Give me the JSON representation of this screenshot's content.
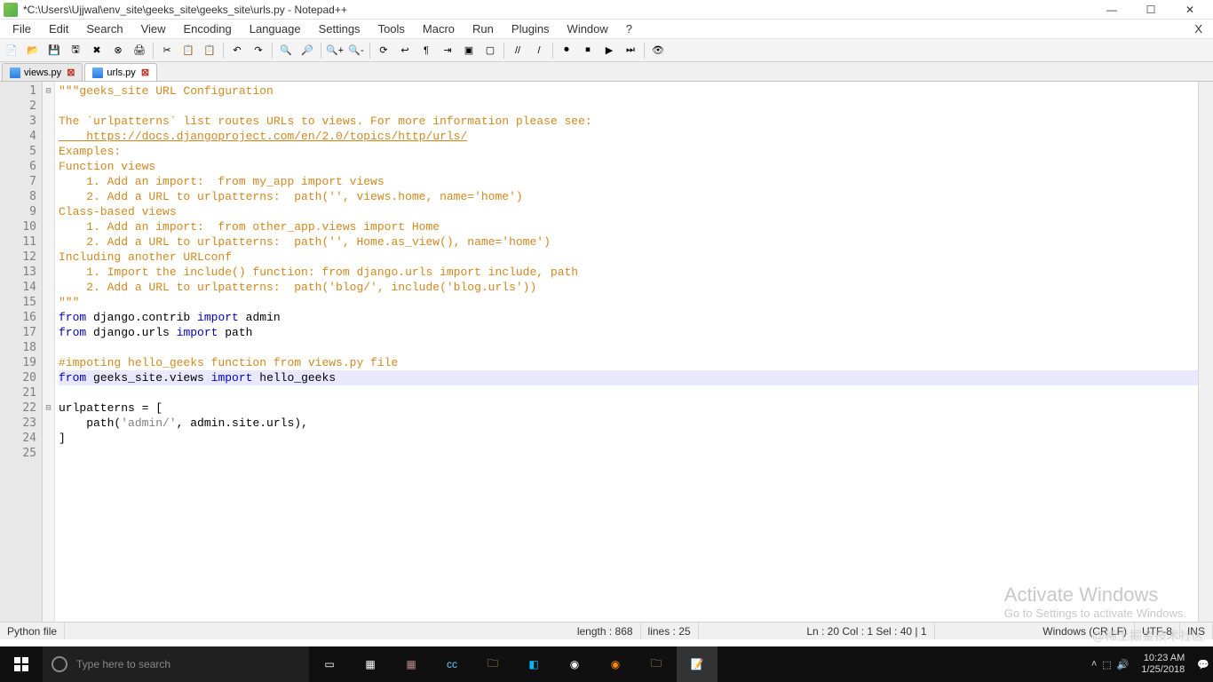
{
  "window": {
    "title": "*C:\\Users\\Ujjwal\\env_site\\geeks_site\\geeks_site\\urls.py - Notepad++"
  },
  "menus": [
    "File",
    "Edit",
    "Search",
    "View",
    "Encoding",
    "Language",
    "Settings",
    "Tools",
    "Macro",
    "Run",
    "Plugins",
    "Window",
    "?"
  ],
  "tabs": [
    {
      "label": "views.py",
      "active": false
    },
    {
      "label": "urls.py",
      "active": true
    }
  ],
  "code": {
    "lines": [
      {
        "n": 1,
        "cls": "s-doc",
        "text": "\"\"\"geeks_site URL Configuration",
        "fold": "⊟"
      },
      {
        "n": 2,
        "cls": "s-doc",
        "text": ""
      },
      {
        "n": 3,
        "cls": "s-doc",
        "text": "The `urlpatterns` list routes URLs to views. For more information please see:"
      },
      {
        "n": 4,
        "cls": "s-link",
        "text": "    https://docs.djangoproject.com/en/2.0/topics/http/urls/"
      },
      {
        "n": 5,
        "cls": "s-doc",
        "text": "Examples:"
      },
      {
        "n": 6,
        "cls": "s-doc",
        "text": "Function views"
      },
      {
        "n": 7,
        "cls": "s-doc",
        "text": "    1. Add an import:  from my_app import views"
      },
      {
        "n": 8,
        "cls": "s-doc",
        "text": "    2. Add a URL to urlpatterns:  path('', views.home, name='home')"
      },
      {
        "n": 9,
        "cls": "s-doc",
        "text": "Class-based views"
      },
      {
        "n": 10,
        "cls": "s-doc",
        "text": "    1. Add an import:  from other_app.views import Home"
      },
      {
        "n": 11,
        "cls": "s-doc",
        "text": "    2. Add a URL to urlpatterns:  path('', Home.as_view(), name='home')"
      },
      {
        "n": 12,
        "cls": "s-doc",
        "text": "Including another URLconf"
      },
      {
        "n": 13,
        "cls": "s-doc",
        "text": "    1. Import the include() function: from django.urls import include, path"
      },
      {
        "n": 14,
        "cls": "s-doc",
        "text": "    2. Add a URL to urlpatterns:  path('blog/', include('blog.urls'))"
      },
      {
        "n": 15,
        "cls": "s-doc",
        "text": "\"\"\""
      },
      {
        "n": 16,
        "html": "<span class='s-kw'>from</span> django.contrib <span class='s-kw'>import</span> admin"
      },
      {
        "n": 17,
        "html": "<span class='s-kw'>from</span> django.urls <span class='s-kw'>import</span> path"
      },
      {
        "n": 18,
        "text": ""
      },
      {
        "n": 19,
        "cls": "s-cm",
        "text": "#impoting hello_geeks function from views.py file"
      },
      {
        "n": 20,
        "hl": true,
        "html": "<span class='s-kw'>from</span> geeks_site.views <span class='s-kw'>import</span> hello_geeks"
      },
      {
        "n": 21,
        "text": ""
      },
      {
        "n": 22,
        "fold": "⊟",
        "html": "urlpatterns = ["
      },
      {
        "n": 23,
        "html": "    path(<span class='s-str'>'admin/'</span>, admin.site.urls),"
      },
      {
        "n": 24,
        "text": "]"
      },
      {
        "n": 25,
        "text": ""
      }
    ]
  },
  "status": {
    "filetype": "Python file",
    "length": "length : 868",
    "lines": "lines : 25",
    "pos": "Ln : 20   Col : 1   Sel : 40 | 1",
    "eol": "Windows (CR LF)",
    "enc": "UTF-8",
    "ins": "INS"
  },
  "watermark": {
    "l1": "Activate Windows",
    "l2": "Go to Settings to activate Windows."
  },
  "taskbar": {
    "search_placeholder": "Type here to search",
    "time": "10:23 AM",
    "date": "1/25/2018"
  },
  "toolbar_icons": [
    "new",
    "open",
    "save",
    "save-all",
    "close",
    "close-all",
    "print",
    "|",
    "cut",
    "copy",
    "paste",
    "|",
    "undo",
    "redo",
    "|",
    "find",
    "replace",
    "|",
    "zoom-in",
    "zoom-out",
    "|",
    "sync",
    "wrap",
    "chars",
    "indent",
    "fold",
    "unfold",
    "|",
    "comment",
    "uncomment",
    "|",
    "record",
    "stop",
    "play",
    "play-multi",
    "|",
    "monitor"
  ],
  "cn_watermark": "@稀土掘金技术社区"
}
